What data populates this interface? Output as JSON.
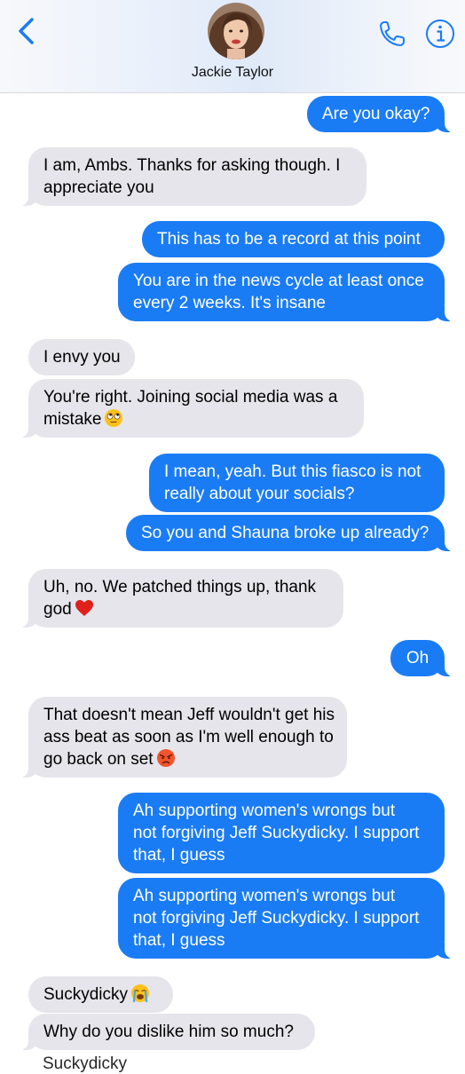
{
  "header": {
    "contact_name": "Jackie Taylor",
    "back_icon": "chevron-left-icon",
    "call_icon": "phone-icon",
    "info_icon": "info-icon",
    "accent": "#1a7cf5"
  },
  "messages": [
    {
      "from": "me",
      "text": "Are you okay?"
    },
    {
      "from": "contact",
      "text": "I am, Ambs. Thanks for asking though. I",
      "text2": "appreciate you"
    },
    {
      "from": "me",
      "text": "This has to be a record at this point"
    },
    {
      "from": "me",
      "text": "You are in the news cycle at least once",
      "text2": "every 2 weeks. It's insane"
    },
    {
      "from": "contact",
      "text": "I envy you"
    },
    {
      "from": "contact",
      "text": "You're right. Joining social media was a",
      "text2": "mistake",
      "emoji": "eye-roll-face"
    },
    {
      "from": "me",
      "text": "I mean, yeah. But this fiasco is not",
      "text2": "really about your socials?"
    },
    {
      "from": "me",
      "text": "So you and Shauna broke up already?"
    },
    {
      "from": "contact",
      "text": "Uh, no. We patched things up, thank",
      "text2": "god",
      "emoji": "red-heart"
    },
    {
      "from": "me",
      "text": "Oh"
    },
    {
      "from": "contact",
      "text": "That doesn't mean Jeff wouldn't get his",
      "text2": "ass beat as soon as I'm well enough to",
      "text3": "go back on set",
      "emoji": "pouting-face"
    },
    {
      "from": "me",
      "text": "Ah supporting women's wrongs but",
      "text2": "not forgiving Jeff Suckydicky. I support",
      "text3": "that, I guess"
    },
    {
      "from": "me",
      "text": "Ah supporting women's wrongs but",
      "text2": "not forgiving Jeff Suckydicky. I support",
      "text3": "that, I guess"
    },
    {
      "from": "contact",
      "text": "Suckydicky",
      "emoji": "loudly-crying-face"
    },
    {
      "from": "contact",
      "text": "Why do you dislike him so much?"
    }
  ],
  "cut_off_text": "Suckydicky"
}
